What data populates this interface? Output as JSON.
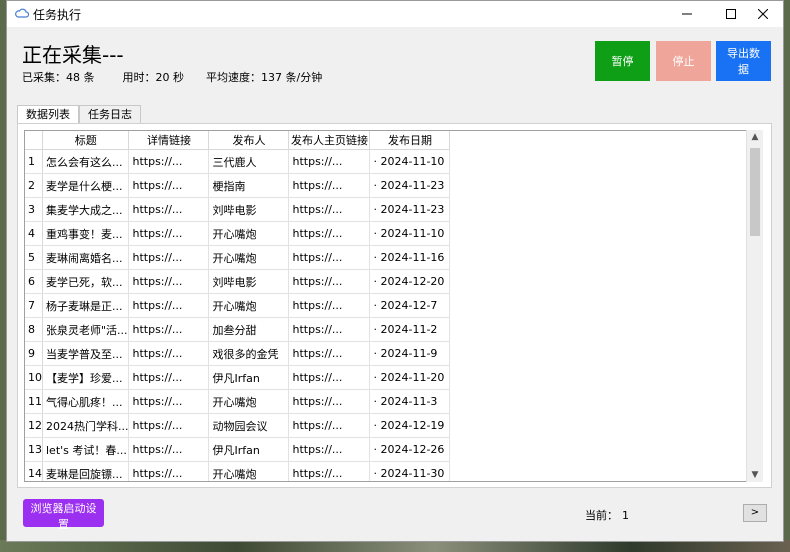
{
  "window": {
    "title": "任务执行"
  },
  "status": {
    "title": "正在采集---",
    "collected_label": "已采集：48 条",
    "time_label": "用时：20 秒",
    "speed_label": "平均速度：137 条/分钟"
  },
  "actions": {
    "pause": "暂停",
    "stop": "停止",
    "export": "导出数据"
  },
  "tabs": [
    {
      "label": "数据列表"
    },
    {
      "label": "任务日志"
    }
  ],
  "table": {
    "columns": [
      "标题",
      "详情链接",
      "发布人",
      "发布人主页链接",
      "发布日期"
    ],
    "rows": [
      {
        "n": "1",
        "title": "怎么会有这么...",
        "link": "https://...",
        "author": "三代鹿人",
        "home": "https://...",
        "date": "· 2024-11-10"
      },
      {
        "n": "2",
        "title": "麦学是什么梗...",
        "link": "https://...",
        "author": "梗指南",
        "home": "https://...",
        "date": "· 2024-11-23"
      },
      {
        "n": "3",
        "title": "集麦学大成之...",
        "link": "https://...",
        "author": "刘哔电影",
        "home": "https://...",
        "date": "· 2024-11-23"
      },
      {
        "n": "4",
        "title": "重鸡事变！麦...",
        "link": "https://...",
        "author": "开心嘴炮",
        "home": "https://...",
        "date": "· 2024-11-10"
      },
      {
        "n": "5",
        "title": "麦琳闹离婚名...",
        "link": "https://...",
        "author": "开心嘴炮",
        "home": "https://...",
        "date": "· 2024-11-16"
      },
      {
        "n": "6",
        "title": "麦学已死，软...",
        "link": "https://...",
        "author": "刘哔电影",
        "home": "https://...",
        "date": "· 2024-12-20"
      },
      {
        "n": "7",
        "title": "杨子麦琳是正...",
        "link": "https://...",
        "author": "开心嘴炮",
        "home": "https://...",
        "date": "· 2024-12-7"
      },
      {
        "n": "8",
        "title": "张泉灵老师\"活...",
        "link": "https://...",
        "author": "加叁分甜",
        "home": "https://...",
        "date": "· 2024-11-2"
      },
      {
        "n": "9",
        "title": "当麦学普及至...",
        "link": "https://...",
        "author": "戏很多的金凭",
        "home": "https://...",
        "date": "· 2024-11-9"
      },
      {
        "n": "10",
        "title": "【麦学】珍爱...",
        "link": "https://...",
        "author": "伊凡Irfan",
        "home": "https://...",
        "date": "· 2024-11-20"
      },
      {
        "n": "11",
        "title": "气得心肌疼！...",
        "link": "https://...",
        "author": "开心嘴炮",
        "home": "https://...",
        "date": "· 2024-11-3"
      },
      {
        "n": "12",
        "title": "2024热门学科...",
        "link": "https://...",
        "author": "动物园会议",
        "home": "https://...",
        "date": "· 2024-12-19"
      },
      {
        "n": "13",
        "title": "let's 考试！春...",
        "link": "https://...",
        "author": "伊凡Irfan",
        "home": "https://...",
        "date": "· 2024-12-26"
      },
      {
        "n": "14",
        "title": "麦琳是回旋镖...",
        "link": "https://...",
        "author": "开心嘴炮",
        "home": "https://...",
        "date": "· 2024-11-30"
      }
    ]
  },
  "footer": {
    "browser_button": "浏览器启动设置",
    "current_label": "当前：",
    "current_value": "1",
    "next": ">"
  }
}
